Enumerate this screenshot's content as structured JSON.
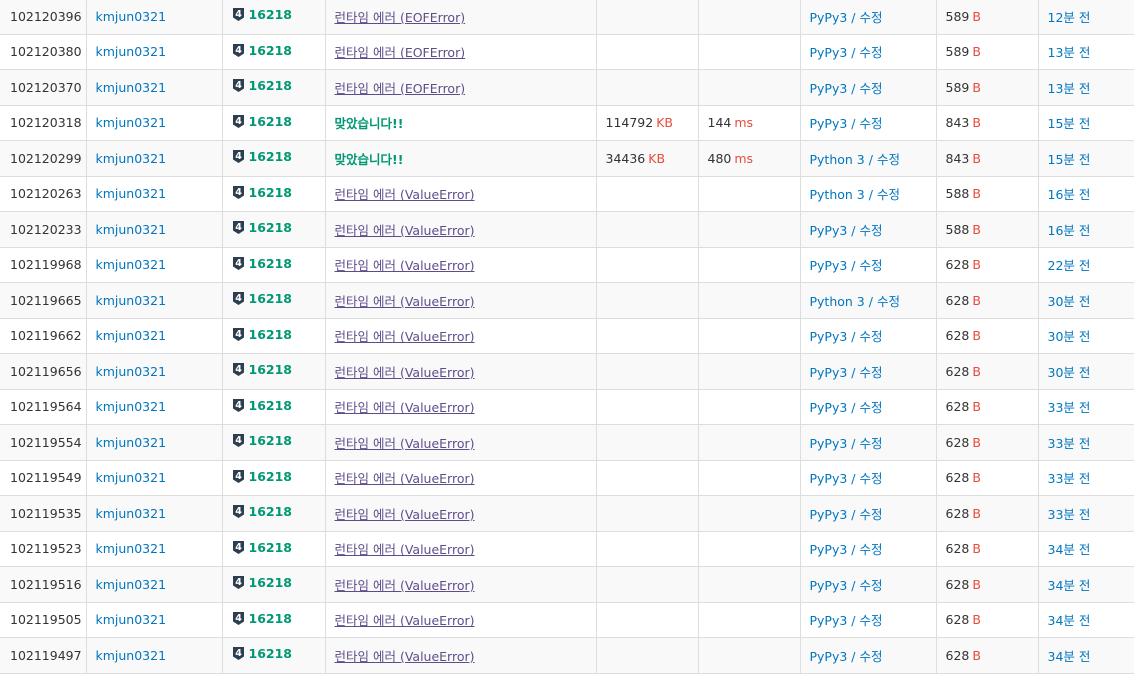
{
  "colors": {
    "link": "#0076c0",
    "accepted": "#009874",
    "error": "#5f4d8b",
    "unit": "#e74c3c",
    "tier_badge": "#2d3e50",
    "row_stripe": "#f9f9f9",
    "border": "#dddddd"
  },
  "icons": {
    "tier": "gold-4-tier-icon"
  },
  "units": {
    "memory": "KB",
    "time": "ms",
    "length": "B"
  },
  "separator": " / ",
  "edit_label": "수정",
  "submissions": [
    {
      "id": "102120396",
      "user": "kmjun0321",
      "tier": "4",
      "problem": "16218",
      "result": "런타임 에러 (EOFError)",
      "accepted": false,
      "memory": "",
      "time": "",
      "language": "PyPy3",
      "length": "589",
      "submitted": "12분 전"
    },
    {
      "id": "102120380",
      "user": "kmjun0321",
      "tier": "4",
      "problem": "16218",
      "result": "런타임 에러 (EOFError)",
      "accepted": false,
      "memory": "",
      "time": "",
      "language": "PyPy3",
      "length": "589",
      "submitted": "13분 전"
    },
    {
      "id": "102120370",
      "user": "kmjun0321",
      "tier": "4",
      "problem": "16218",
      "result": "런타임 에러 (EOFError)",
      "accepted": false,
      "memory": "",
      "time": "",
      "language": "PyPy3",
      "length": "589",
      "submitted": "13분 전"
    },
    {
      "id": "102120318",
      "user": "kmjun0321",
      "tier": "4",
      "problem": "16218",
      "result": "맞았습니다!!",
      "accepted": true,
      "memory": "114792",
      "time": "144",
      "language": "PyPy3",
      "length": "843",
      "submitted": "15분 전"
    },
    {
      "id": "102120299",
      "user": "kmjun0321",
      "tier": "4",
      "problem": "16218",
      "result": "맞았습니다!!",
      "accepted": true,
      "memory": "34436",
      "time": "480",
      "language": "Python 3",
      "length": "843",
      "submitted": "15분 전"
    },
    {
      "id": "102120263",
      "user": "kmjun0321",
      "tier": "4",
      "problem": "16218",
      "result": "런타임 에러 (ValueError)",
      "accepted": false,
      "memory": "",
      "time": "",
      "language": "Python 3",
      "length": "588",
      "submitted": "16분 전"
    },
    {
      "id": "102120233",
      "user": "kmjun0321",
      "tier": "4",
      "problem": "16218",
      "result": "런타임 에러 (ValueError)",
      "accepted": false,
      "memory": "",
      "time": "",
      "language": "PyPy3",
      "length": "588",
      "submitted": "16분 전"
    },
    {
      "id": "102119968",
      "user": "kmjun0321",
      "tier": "4",
      "problem": "16218",
      "result": "런타임 에러 (ValueError)",
      "accepted": false,
      "memory": "",
      "time": "",
      "language": "PyPy3",
      "length": "628",
      "submitted": "22분 전"
    },
    {
      "id": "102119665",
      "user": "kmjun0321",
      "tier": "4",
      "problem": "16218",
      "result": "런타임 에러 (ValueError)",
      "accepted": false,
      "memory": "",
      "time": "",
      "language": "Python 3",
      "length": "628",
      "submitted": "30분 전"
    },
    {
      "id": "102119662",
      "user": "kmjun0321",
      "tier": "4",
      "problem": "16218",
      "result": "런타임 에러 (ValueError)",
      "accepted": false,
      "memory": "",
      "time": "",
      "language": "PyPy3",
      "length": "628",
      "submitted": "30분 전"
    },
    {
      "id": "102119656",
      "user": "kmjun0321",
      "tier": "4",
      "problem": "16218",
      "result": "런타임 에러 (ValueError)",
      "accepted": false,
      "memory": "",
      "time": "",
      "language": "PyPy3",
      "length": "628",
      "submitted": "30분 전"
    },
    {
      "id": "102119564",
      "user": "kmjun0321",
      "tier": "4",
      "problem": "16218",
      "result": "런타임 에러 (ValueError)",
      "accepted": false,
      "memory": "",
      "time": "",
      "language": "PyPy3",
      "length": "628",
      "submitted": "33분 전"
    },
    {
      "id": "102119554",
      "user": "kmjun0321",
      "tier": "4",
      "problem": "16218",
      "result": "런타임 에러 (ValueError)",
      "accepted": false,
      "memory": "",
      "time": "",
      "language": "PyPy3",
      "length": "628",
      "submitted": "33분 전"
    },
    {
      "id": "102119549",
      "user": "kmjun0321",
      "tier": "4",
      "problem": "16218",
      "result": "런타임 에러 (ValueError)",
      "accepted": false,
      "memory": "",
      "time": "",
      "language": "PyPy3",
      "length": "628",
      "submitted": "33분 전"
    },
    {
      "id": "102119535",
      "user": "kmjun0321",
      "tier": "4",
      "problem": "16218",
      "result": "런타임 에러 (ValueError)",
      "accepted": false,
      "memory": "",
      "time": "",
      "language": "PyPy3",
      "length": "628",
      "submitted": "33분 전"
    },
    {
      "id": "102119523",
      "user": "kmjun0321",
      "tier": "4",
      "problem": "16218",
      "result": "런타임 에러 (ValueError)",
      "accepted": false,
      "memory": "",
      "time": "",
      "language": "PyPy3",
      "length": "628",
      "submitted": "34분 전"
    },
    {
      "id": "102119516",
      "user": "kmjun0321",
      "tier": "4",
      "problem": "16218",
      "result": "런타임 에러 (ValueError)",
      "accepted": false,
      "memory": "",
      "time": "",
      "language": "PyPy3",
      "length": "628",
      "submitted": "34분 전"
    },
    {
      "id": "102119505",
      "user": "kmjun0321",
      "tier": "4",
      "problem": "16218",
      "result": "런타임 에러 (ValueError)",
      "accepted": false,
      "memory": "",
      "time": "",
      "language": "PyPy3",
      "length": "628",
      "submitted": "34분 전"
    },
    {
      "id": "102119497",
      "user": "kmjun0321",
      "tier": "4",
      "problem": "16218",
      "result": "런타임 에러 (ValueError)",
      "accepted": false,
      "memory": "",
      "time": "",
      "language": "PyPy3",
      "length": "628",
      "submitted": "34분 전"
    }
  ]
}
